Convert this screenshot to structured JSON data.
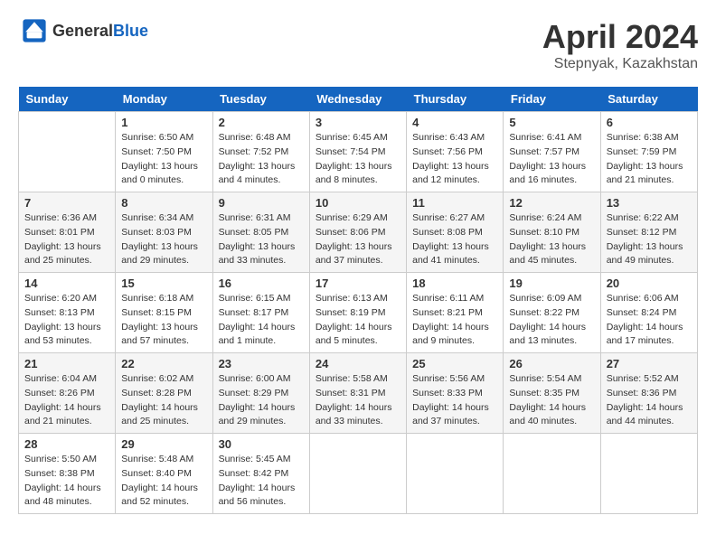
{
  "header": {
    "logo_general": "General",
    "logo_blue": "Blue",
    "month": "April 2024",
    "location": "Stepnyak, Kazakhstan"
  },
  "days_of_week": [
    "Sunday",
    "Monday",
    "Tuesday",
    "Wednesday",
    "Thursday",
    "Friday",
    "Saturday"
  ],
  "weeks": [
    [
      {
        "day": "",
        "info": ""
      },
      {
        "day": "1",
        "info": "Sunrise: 6:50 AM\nSunset: 7:50 PM\nDaylight: 13 hours\nand 0 minutes."
      },
      {
        "day": "2",
        "info": "Sunrise: 6:48 AM\nSunset: 7:52 PM\nDaylight: 13 hours\nand 4 minutes."
      },
      {
        "day": "3",
        "info": "Sunrise: 6:45 AM\nSunset: 7:54 PM\nDaylight: 13 hours\nand 8 minutes."
      },
      {
        "day": "4",
        "info": "Sunrise: 6:43 AM\nSunset: 7:56 PM\nDaylight: 13 hours\nand 12 minutes."
      },
      {
        "day": "5",
        "info": "Sunrise: 6:41 AM\nSunset: 7:57 PM\nDaylight: 13 hours\nand 16 minutes."
      },
      {
        "day": "6",
        "info": "Sunrise: 6:38 AM\nSunset: 7:59 PM\nDaylight: 13 hours\nand 21 minutes."
      }
    ],
    [
      {
        "day": "7",
        "info": "Sunrise: 6:36 AM\nSunset: 8:01 PM\nDaylight: 13 hours\nand 25 minutes."
      },
      {
        "day": "8",
        "info": "Sunrise: 6:34 AM\nSunset: 8:03 PM\nDaylight: 13 hours\nand 29 minutes."
      },
      {
        "day": "9",
        "info": "Sunrise: 6:31 AM\nSunset: 8:05 PM\nDaylight: 13 hours\nand 33 minutes."
      },
      {
        "day": "10",
        "info": "Sunrise: 6:29 AM\nSunset: 8:06 PM\nDaylight: 13 hours\nand 37 minutes."
      },
      {
        "day": "11",
        "info": "Sunrise: 6:27 AM\nSunset: 8:08 PM\nDaylight: 13 hours\nand 41 minutes."
      },
      {
        "day": "12",
        "info": "Sunrise: 6:24 AM\nSunset: 8:10 PM\nDaylight: 13 hours\nand 45 minutes."
      },
      {
        "day": "13",
        "info": "Sunrise: 6:22 AM\nSunset: 8:12 PM\nDaylight: 13 hours\nand 49 minutes."
      }
    ],
    [
      {
        "day": "14",
        "info": "Sunrise: 6:20 AM\nSunset: 8:13 PM\nDaylight: 13 hours\nand 53 minutes."
      },
      {
        "day": "15",
        "info": "Sunrise: 6:18 AM\nSunset: 8:15 PM\nDaylight: 13 hours\nand 57 minutes."
      },
      {
        "day": "16",
        "info": "Sunrise: 6:15 AM\nSunset: 8:17 PM\nDaylight: 14 hours\nand 1 minute."
      },
      {
        "day": "17",
        "info": "Sunrise: 6:13 AM\nSunset: 8:19 PM\nDaylight: 14 hours\nand 5 minutes."
      },
      {
        "day": "18",
        "info": "Sunrise: 6:11 AM\nSunset: 8:21 PM\nDaylight: 14 hours\nand 9 minutes."
      },
      {
        "day": "19",
        "info": "Sunrise: 6:09 AM\nSunset: 8:22 PM\nDaylight: 14 hours\nand 13 minutes."
      },
      {
        "day": "20",
        "info": "Sunrise: 6:06 AM\nSunset: 8:24 PM\nDaylight: 14 hours\nand 17 minutes."
      }
    ],
    [
      {
        "day": "21",
        "info": "Sunrise: 6:04 AM\nSunset: 8:26 PM\nDaylight: 14 hours\nand 21 minutes."
      },
      {
        "day": "22",
        "info": "Sunrise: 6:02 AM\nSunset: 8:28 PM\nDaylight: 14 hours\nand 25 minutes."
      },
      {
        "day": "23",
        "info": "Sunrise: 6:00 AM\nSunset: 8:29 PM\nDaylight: 14 hours\nand 29 minutes."
      },
      {
        "day": "24",
        "info": "Sunrise: 5:58 AM\nSunset: 8:31 PM\nDaylight: 14 hours\nand 33 minutes."
      },
      {
        "day": "25",
        "info": "Sunrise: 5:56 AM\nSunset: 8:33 PM\nDaylight: 14 hours\nand 37 minutes."
      },
      {
        "day": "26",
        "info": "Sunrise: 5:54 AM\nSunset: 8:35 PM\nDaylight: 14 hours\nand 40 minutes."
      },
      {
        "day": "27",
        "info": "Sunrise: 5:52 AM\nSunset: 8:36 PM\nDaylight: 14 hours\nand 44 minutes."
      }
    ],
    [
      {
        "day": "28",
        "info": "Sunrise: 5:50 AM\nSunset: 8:38 PM\nDaylight: 14 hours\nand 48 minutes."
      },
      {
        "day": "29",
        "info": "Sunrise: 5:48 AM\nSunset: 8:40 PM\nDaylight: 14 hours\nand 52 minutes."
      },
      {
        "day": "30",
        "info": "Sunrise: 5:45 AM\nSunset: 8:42 PM\nDaylight: 14 hours\nand 56 minutes."
      },
      {
        "day": "",
        "info": ""
      },
      {
        "day": "",
        "info": ""
      },
      {
        "day": "",
        "info": ""
      },
      {
        "day": "",
        "info": ""
      }
    ]
  ]
}
